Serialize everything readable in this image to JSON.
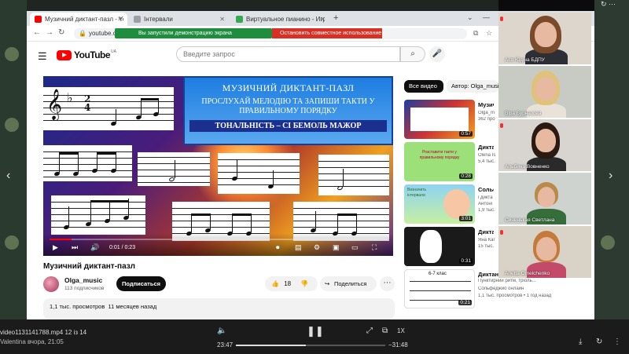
{
  "browser": {
    "tabs": [
      {
        "label": "Музичний диктант-пазл - YouTube",
        "icon": "youtube-favicon"
      },
      {
        "label": "Інтервали",
        "icon": "page-favicon"
      },
      {
        "label": "Виртуальное пианино - Играт",
        "icon": "piano-favicon"
      }
    ],
    "url": "youtube.co",
    "share_banner": "Вы запустили демонстрацию экрана",
    "stop_share": "Остановить совместное использование"
  },
  "youtube": {
    "logo_text": "YouTube",
    "country": "UA",
    "search_placeholder": "Введите запрос"
  },
  "video": {
    "slide_title": "МУЗИЧНИЙ ДИКТАНТ-ПАЗЛ",
    "slide_instruction": "ПРОСЛУХАЙ МЕЛОДІЮ ТА ЗАПИШИ ТАКТИ У ПРАВИЛЬНОМУ ПОРЯДКУ",
    "slide_key": "ТОНАЛЬНІСТЬ – СІ БЕМОЛЬ МАЖОР",
    "time": "0:01 / 0:23",
    "progress": 0.065,
    "title": "Музичний диктант-пазл",
    "channel": "Olga_music",
    "subscribers": "113 подписчиков",
    "subscribe_label": "Подписаться",
    "likes": "18",
    "share_label": "Поделиться",
    "views": "1,1 тыс. просмотров",
    "date": "11 месяцев назад"
  },
  "sidebar": {
    "chips": [
      "Все видео",
      "Автор: Olga_music"
    ],
    "recs": [
      {
        "title": "Музич",
        "l1": "Olga_m",
        "l2": "362 про",
        "duration": "0:57",
        "thumb_text": ""
      },
      {
        "title": "Дикта",
        "l1": "Olena Is",
        "l2": "5,4 тыс.",
        "duration": "0:28",
        "thumb_text": "Розставити такти у правильному порядку"
      },
      {
        "title": "Сольф",
        "l1": "і дикта",
        "l2": "Антоні",
        "l3": "1,9 тыс.",
        "duration": "3:01",
        "thumb_text": "Визначить інтервали"
      },
      {
        "title": "Дикта",
        "l1": "Яна Каг",
        "l2": "15 тыс.",
        "duration": "0:31",
        "thumb_text": ""
      },
      {
        "title": "Диктант",
        "l1": "Пунктирний ритм, тріоль...",
        "l2": "Сольфеджио онлайн",
        "l3": "1,1 тыс. просмотров • 1 год назад",
        "duration": "0:21",
        "thumb_text": "6-7 клас"
      }
    ]
  },
  "participants": [
    {
      "name": "Ася Юдіна БДПУ"
    },
    {
      "name": "Віра Бурназова"
    },
    {
      "name": "Альбина Вовненко"
    },
    {
      "name": "Синенькая Светлана"
    },
    {
      "name": "Anetta Omelchenko"
    }
  ],
  "media": {
    "file": "video1131141788.mp4 12 із 14",
    "sender": "Valentina вчора, 21:05",
    "elapsed": "23:47",
    "remaining": "−31:48",
    "speed": "1X",
    "progress": 0.47
  },
  "colors": {
    "accent": "#ff0000",
    "share_green": "#1e8e3e",
    "stop_red": "#d93025"
  }
}
